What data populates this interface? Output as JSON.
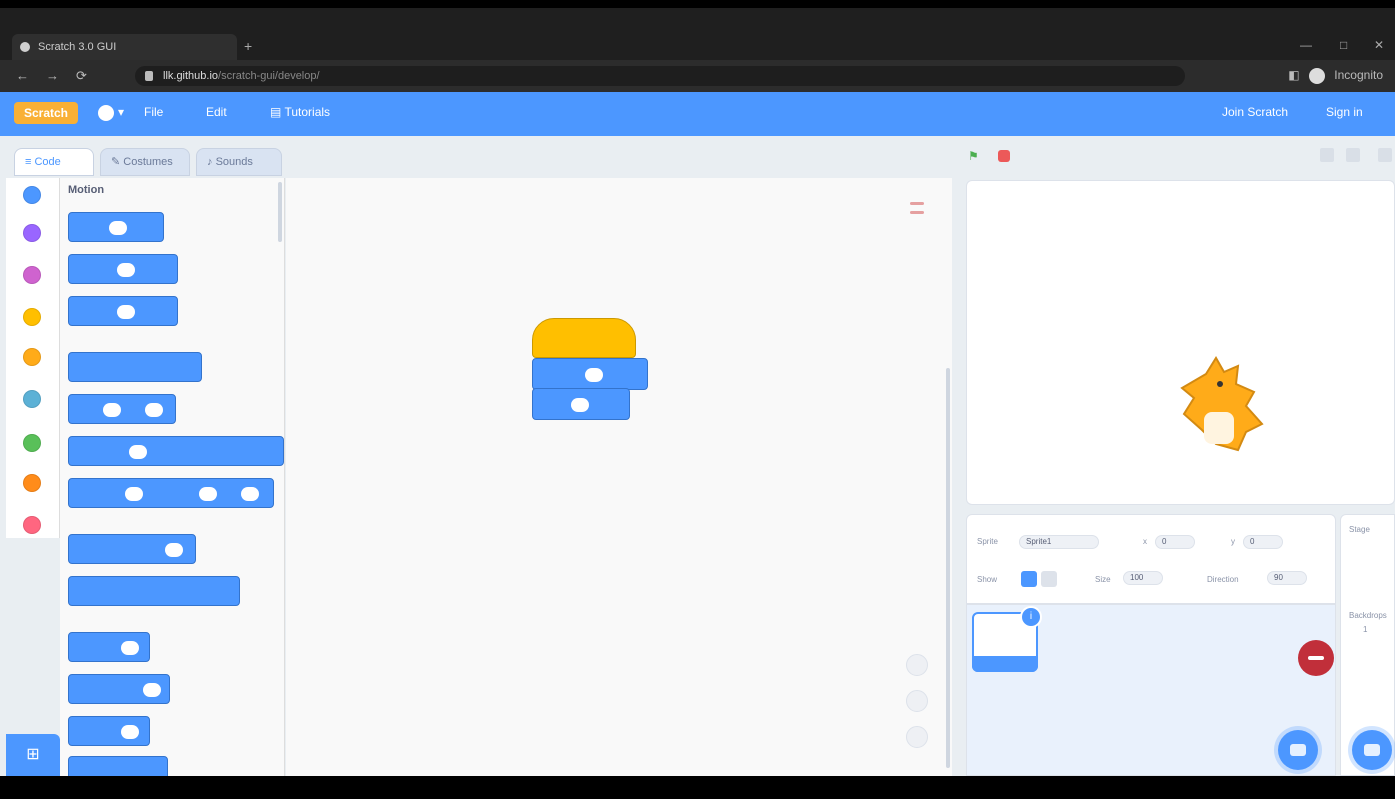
{
  "browser": {
    "tab_title": "Scratch 3.0 GUI",
    "new_tab_glyph": "+",
    "window_controls": [
      "—",
      "□",
      "✕"
    ],
    "url_host": "llk.github.io",
    "url_path": "/scratch-gui/develop/",
    "nav_glyphs": [
      "←",
      "→",
      "⟳"
    ],
    "profile_label": "Incognito"
  },
  "menubar": {
    "logo": "Scratch",
    "items": [
      "File",
      "Edit"
    ],
    "tutorials": "Tutorials",
    "right_items": [
      "Join Scratch",
      "Sign in"
    ]
  },
  "editor_tabs": [
    "Code",
    "Costumes",
    "Sounds"
  ],
  "palette": {
    "category_title": "Motion",
    "category_colors": [
      "#4c97ff",
      "#9966ff",
      "#cf63cf",
      "#ffbf00",
      "#ffab19",
      "#5cb1d6",
      "#59c059",
      "#ff8c1a",
      "#ff6680"
    ],
    "extension_icon": "extension-icon"
  },
  "colors": {
    "accent": "#4c97ff",
    "events": "#ffbf00",
    "stop": "#ec5959",
    "delete": "#c12f3a"
  },
  "stage": {
    "flag_icon": "green-flag-icon",
    "stop_icon": "stop-icon"
  },
  "sprite_info": {
    "sprite_label": "Sprite",
    "sprite_name": "Sprite1",
    "x_label": "x",
    "x_value": "0",
    "y_label": "y",
    "y_value": "0",
    "show_label": "Show",
    "size_label": "Size",
    "size_value": "100",
    "direction_label": "Direction",
    "direction_value": "90",
    "stage_label": "Stage",
    "backdrops_label": "Backdrops",
    "backdrops_count": "1"
  }
}
